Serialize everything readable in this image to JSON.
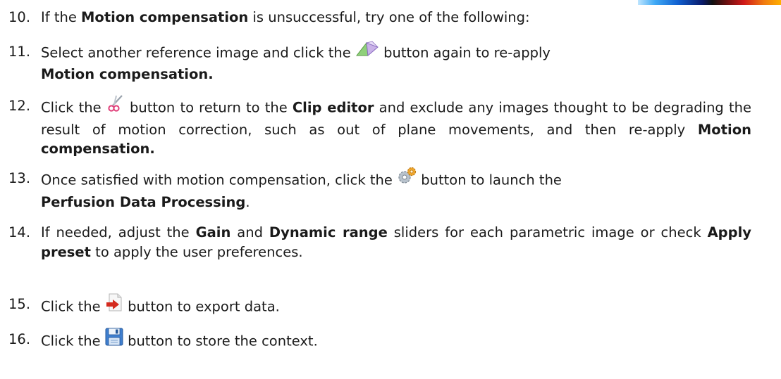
{
  "steps": [
    {
      "num": "10.",
      "parts": [
        "If the ",
        "Motion compensation",
        " is unsuccessful, try one of the following:"
      ]
    },
    {
      "num": "11.",
      "parts": [
        "Select another reference image and click the ",
        " button again to re-apply ",
        "Motion compensation."
      ]
    },
    {
      "num": "12.",
      "parts": [
        "Click the ",
        " button to return to the ",
        "Clip editor",
        " and exclude any images thought to be degrading the result of motion correction, such as out of plane movements, and then re-apply ",
        "Motion compensation."
      ]
    },
    {
      "num": "13.",
      "parts": [
        "Once satisfied with motion compensation, click the ",
        " button to launch the ",
        "Perfusion Data Processing",
        "."
      ]
    },
    {
      "num": "14.",
      "parts": [
        "If needed, adjust the ",
        "Gain",
        " and ",
        "Dynamic range",
        " sliders for each parametric image or check ",
        "Apply preset",
        " to apply the user preferences."
      ]
    },
    {
      "num": "15.",
      "parts": [
        "Click the ",
        " button to export data."
      ]
    },
    {
      "num": "16.",
      "parts": [
        "Click the ",
        " button to store the context."
      ]
    }
  ],
  "icons": {
    "motion_compensation": "motion-compensation-icon",
    "clip_editor": "scissors-icon",
    "perfusion_processing": "gears-icon",
    "export": "export-data-icon",
    "store": "save-floppy-icon"
  },
  "colors": {
    "text": "#1a1a1a"
  }
}
